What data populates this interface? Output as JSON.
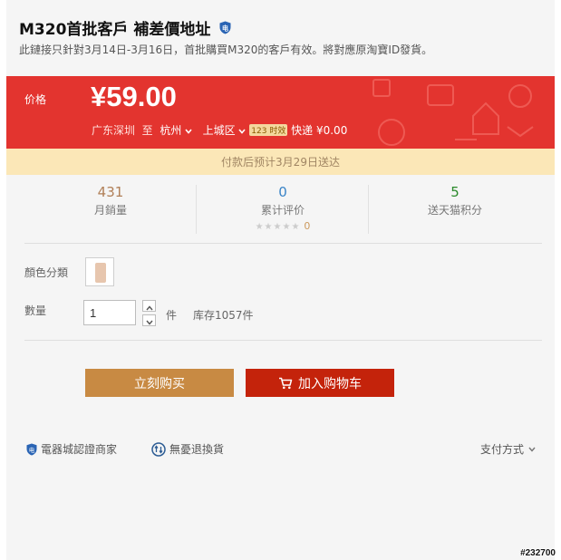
{
  "product": {
    "title": "M320首批客戶 補差價地址",
    "subtitle": "此鏈接只針對3月14日-3月16日，首批購買M320的客戶有效。將對應原淘寶ID發貨。"
  },
  "price": {
    "label": "价格",
    "value": "¥59.00"
  },
  "shipping": {
    "origin": "广东深圳",
    "to_label": "至",
    "city": "杭州",
    "district": "上城区",
    "timeliness_badge": "123 时效",
    "express": "快递 ¥0.00"
  },
  "delivery_notice": "付款后预计3月29日送达",
  "stats": {
    "monthly_sales": {
      "value": "431",
      "label": "月銷量"
    },
    "reviews": {
      "value": "0",
      "label": "累计评价",
      "stars": "★★★★★",
      "review_count": "0"
    },
    "points": {
      "value": "5",
      "label": "送天猫积分"
    }
  },
  "options": {
    "color_label": "顏色分類",
    "quantity_label": "數量",
    "quantity_value": "1",
    "unit": "件",
    "stock": "库存1057件"
  },
  "actions": {
    "buy_now": "立刻购买",
    "add_to_cart": "加入购物车"
  },
  "footer": {
    "certified": "電器城認證商家",
    "no_worry_return": "無憂退換貨",
    "payment": "支付方式"
  },
  "watermark": "#232700",
  "colors": {
    "price_bg": "#e3342f",
    "notice_bg": "#fbe7b7",
    "buy_button": "#c88a43",
    "cart_button": "#c4230b",
    "sales_number": "#b07f57",
    "reviews_number": "#3a84c7",
    "points_number": "#2b8a2b"
  },
  "icons": {
    "title_badge": "shield-icon",
    "cart": "cart-icon",
    "certified": "shield-icon",
    "return": "return-icon",
    "dropdown": "chevron-down-icon"
  }
}
